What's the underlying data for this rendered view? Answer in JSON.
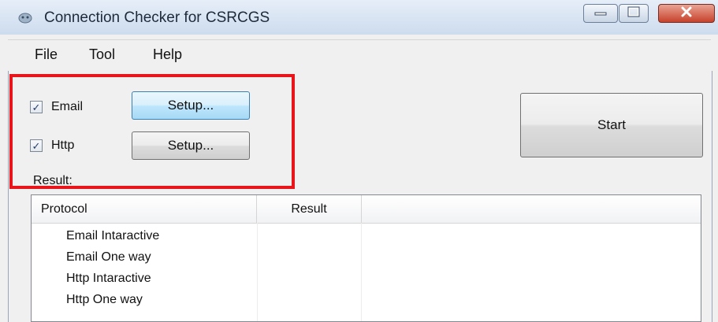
{
  "window": {
    "title": "Connection Checker for CSRCGS",
    "controls": {
      "minimize": "minimize-icon",
      "maximize": "maximize-icon",
      "close": "close-icon"
    }
  },
  "menu": {
    "items": [
      "File",
      "Tool",
      "Help"
    ]
  },
  "options": [
    {
      "label": "Email",
      "checked": true,
      "setup_label": "Setup..."
    },
    {
      "label": "Http",
      "checked": true,
      "setup_label": "Setup..."
    }
  ],
  "start_label": "Start",
  "result_label": "Result:",
  "table": {
    "columns": [
      "Protocol",
      "Result"
    ],
    "rows": [
      {
        "protocol": "Email Intaractive",
        "result": ""
      },
      {
        "protocol": "Email One way",
        "result": ""
      },
      {
        "protocol": "Http Intaractive",
        "result": ""
      },
      {
        "protocol": "Http One way",
        "result": ""
      }
    ]
  },
  "colors": {
    "highlight": "#e8151b",
    "title_bar": "#cddcee",
    "close_button": "#c7422b"
  }
}
